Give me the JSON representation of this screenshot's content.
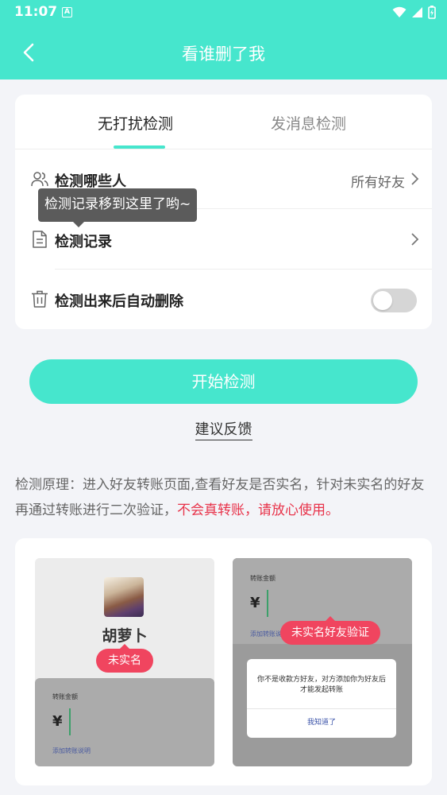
{
  "status_bar": {
    "time": "11:07",
    "notification_badge": "A"
  },
  "header": {
    "title": "看谁删了我"
  },
  "tabs": [
    {
      "label": "无打扰检测",
      "active": true
    },
    {
      "label": "发消息检测",
      "active": false
    }
  ],
  "rows": [
    {
      "label": "检测哪些人",
      "value": "所有好友",
      "icon": "people-icon"
    },
    {
      "label": "检测记录",
      "value": "",
      "icon": "document-icon"
    },
    {
      "label": "检测出来后自动删除",
      "icon": "trash-icon",
      "toggle_on": false
    }
  ],
  "tooltip": "检测记录移到这里了哟~",
  "start_button": "开始检测",
  "feedback_link": "建议反馈",
  "principle": {
    "text": "检测原理：进入好友转账页面,查看好友是否实名，针对未实名的好友再通过转账进行二次验证，",
    "warning": "不会真转账，请放心使用。"
  },
  "illustration": {
    "left": {
      "name": "胡萝卜",
      "badge": "未实名",
      "amount_label": "转账金额",
      "currency": "¥",
      "note_link": "添加转账说明"
    },
    "right": {
      "amount_label": "转账金额",
      "currency": "¥",
      "note_link": "添加转账说",
      "badge": "未实名好友验证",
      "dialog_text": "你不是收款方好友，对方添加你为好友后才能发起转账",
      "dialog_button": "我知道了"
    }
  },
  "colors": {
    "accent": "#46e6cd",
    "warning": "#e8334a",
    "badge": "#f0455f"
  }
}
